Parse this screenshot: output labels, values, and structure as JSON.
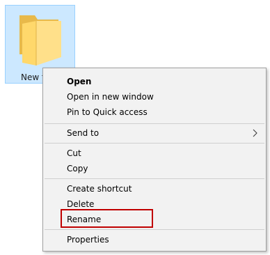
{
  "folder": {
    "label": "New fo",
    "icon": "folder-icon",
    "selected": true,
    "colors": {
      "selection_fill": "#cce8ff",
      "folder_body": "#ffd86b"
    }
  },
  "context_menu": {
    "items": [
      {
        "label": "Open",
        "bold": true
      },
      {
        "label": "Open in new window"
      },
      {
        "label": "Pin to Quick access"
      },
      {
        "label": "Send to",
        "submenu": true,
        "icon": "chevron-right-icon"
      },
      {
        "label": "Cut"
      },
      {
        "label": "Copy"
      },
      {
        "label": "Create shortcut"
      },
      {
        "label": "Delete"
      },
      {
        "label": "Rename",
        "highlighted": true
      },
      {
        "label": "Properties"
      }
    ],
    "highlight_color": "#c00000"
  }
}
